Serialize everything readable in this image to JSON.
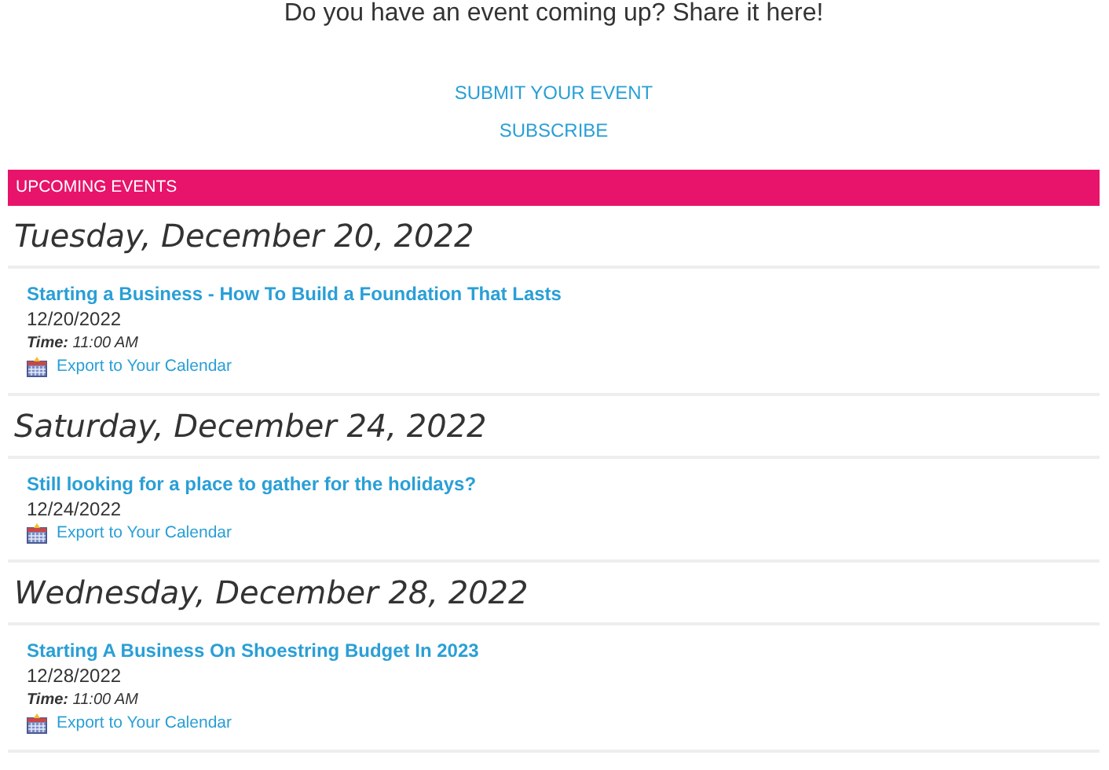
{
  "intro": "Do you have an event coming up? Share it here!",
  "links": [
    "SUBMIT YOUR EVENT",
    "SUBSCRIBE"
  ],
  "section_title": "UPCOMING EVENTS",
  "days": [
    {
      "date": "Tuesday, December 20, 2022",
      "events": [
        {
          "title": "Starting a Business - How To Build a Foundation That Lasts",
          "date": "12/20/2022",
          "time_label": "Time:",
          "time": "11:00 AM",
          "export": "Export to Your Calendar"
        }
      ]
    },
    {
      "date": "Saturday, December 24, 2022",
      "events": [
        {
          "title": "Still looking for a place to gather for the holidays?",
          "date": "12/24/2022",
          "export": "Export to Your Calendar"
        }
      ]
    },
    {
      "date": "Wednesday, December 28, 2022",
      "events": [
        {
          "title": "Starting A Business On Shoestring Budget In 2023",
          "date": "12/28/2022",
          "time_label": "Time:",
          "time": "11:00 AM",
          "export": "Export to Your Calendar"
        }
      ]
    }
  ]
}
